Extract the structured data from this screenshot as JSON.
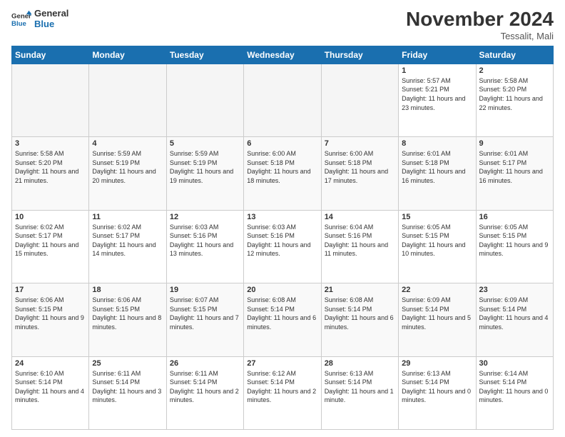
{
  "header": {
    "logo_line1": "General",
    "logo_line2": "Blue",
    "month": "November 2024",
    "location": "Tessalit, Mali"
  },
  "days_of_week": [
    "Sunday",
    "Monday",
    "Tuesday",
    "Wednesday",
    "Thursday",
    "Friday",
    "Saturday"
  ],
  "weeks": [
    [
      {
        "day": "",
        "empty": true
      },
      {
        "day": "",
        "empty": true
      },
      {
        "day": "",
        "empty": true
      },
      {
        "day": "",
        "empty": true
      },
      {
        "day": "",
        "empty": true
      },
      {
        "day": "1",
        "sunrise": "5:57 AM",
        "sunset": "5:21 PM",
        "daylight": "11 hours and 23 minutes."
      },
      {
        "day": "2",
        "sunrise": "5:58 AM",
        "sunset": "5:20 PM",
        "daylight": "11 hours and 22 minutes."
      }
    ],
    [
      {
        "day": "3",
        "sunrise": "5:58 AM",
        "sunset": "5:20 PM",
        "daylight": "11 hours and 21 minutes."
      },
      {
        "day": "4",
        "sunrise": "5:59 AM",
        "sunset": "5:19 PM",
        "daylight": "11 hours and 20 minutes."
      },
      {
        "day": "5",
        "sunrise": "5:59 AM",
        "sunset": "5:19 PM",
        "daylight": "11 hours and 19 minutes."
      },
      {
        "day": "6",
        "sunrise": "6:00 AM",
        "sunset": "5:18 PM",
        "daylight": "11 hours and 18 minutes."
      },
      {
        "day": "7",
        "sunrise": "6:00 AM",
        "sunset": "5:18 PM",
        "daylight": "11 hours and 17 minutes."
      },
      {
        "day": "8",
        "sunrise": "6:01 AM",
        "sunset": "5:18 PM",
        "daylight": "11 hours and 16 minutes."
      },
      {
        "day": "9",
        "sunrise": "6:01 AM",
        "sunset": "5:17 PM",
        "daylight": "11 hours and 16 minutes."
      }
    ],
    [
      {
        "day": "10",
        "sunrise": "6:02 AM",
        "sunset": "5:17 PM",
        "daylight": "11 hours and 15 minutes."
      },
      {
        "day": "11",
        "sunrise": "6:02 AM",
        "sunset": "5:17 PM",
        "daylight": "11 hours and 14 minutes."
      },
      {
        "day": "12",
        "sunrise": "6:03 AM",
        "sunset": "5:16 PM",
        "daylight": "11 hours and 13 minutes."
      },
      {
        "day": "13",
        "sunrise": "6:03 AM",
        "sunset": "5:16 PM",
        "daylight": "11 hours and 12 minutes."
      },
      {
        "day": "14",
        "sunrise": "6:04 AM",
        "sunset": "5:16 PM",
        "daylight": "11 hours and 11 minutes."
      },
      {
        "day": "15",
        "sunrise": "6:05 AM",
        "sunset": "5:15 PM",
        "daylight": "11 hours and 10 minutes."
      },
      {
        "day": "16",
        "sunrise": "6:05 AM",
        "sunset": "5:15 PM",
        "daylight": "11 hours and 9 minutes."
      }
    ],
    [
      {
        "day": "17",
        "sunrise": "6:06 AM",
        "sunset": "5:15 PM",
        "daylight": "11 hours and 9 minutes."
      },
      {
        "day": "18",
        "sunrise": "6:06 AM",
        "sunset": "5:15 PM",
        "daylight": "11 hours and 8 minutes."
      },
      {
        "day": "19",
        "sunrise": "6:07 AM",
        "sunset": "5:15 PM",
        "daylight": "11 hours and 7 minutes."
      },
      {
        "day": "20",
        "sunrise": "6:08 AM",
        "sunset": "5:14 PM",
        "daylight": "11 hours and 6 minutes."
      },
      {
        "day": "21",
        "sunrise": "6:08 AM",
        "sunset": "5:14 PM",
        "daylight": "11 hours and 6 minutes."
      },
      {
        "day": "22",
        "sunrise": "6:09 AM",
        "sunset": "5:14 PM",
        "daylight": "11 hours and 5 minutes."
      },
      {
        "day": "23",
        "sunrise": "6:09 AM",
        "sunset": "5:14 PM",
        "daylight": "11 hours and 4 minutes."
      }
    ],
    [
      {
        "day": "24",
        "sunrise": "6:10 AM",
        "sunset": "5:14 PM",
        "daylight": "11 hours and 4 minutes."
      },
      {
        "day": "25",
        "sunrise": "6:11 AM",
        "sunset": "5:14 PM",
        "daylight": "11 hours and 3 minutes."
      },
      {
        "day": "26",
        "sunrise": "6:11 AM",
        "sunset": "5:14 PM",
        "daylight": "11 hours and 2 minutes."
      },
      {
        "day": "27",
        "sunrise": "6:12 AM",
        "sunset": "5:14 PM",
        "daylight": "11 hours and 2 minutes."
      },
      {
        "day": "28",
        "sunrise": "6:13 AM",
        "sunset": "5:14 PM",
        "daylight": "11 hours and 1 minute."
      },
      {
        "day": "29",
        "sunrise": "6:13 AM",
        "sunset": "5:14 PM",
        "daylight": "11 hours and 0 minutes."
      },
      {
        "day": "30",
        "sunrise": "6:14 AM",
        "sunset": "5:14 PM",
        "daylight": "11 hours and 0 minutes."
      }
    ]
  ],
  "labels": {
    "sunrise": "Sunrise:",
    "sunset": "Sunset:",
    "daylight": "Daylight:"
  }
}
